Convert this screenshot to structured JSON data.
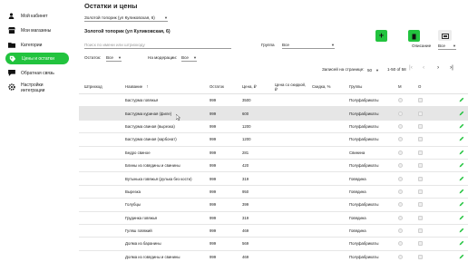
{
  "sidebar": {
    "items": [
      {
        "label": "Мой кабинет",
        "icon": "person-icon",
        "active": false
      },
      {
        "label": "Мои магазины",
        "icon": "store-icon",
        "active": false
      },
      {
        "label": "Категории",
        "icon": "folder-icon",
        "active": false
      },
      {
        "label": "Цены и остатки",
        "icon": "price-tag-icon",
        "active": true
      },
      {
        "label": "Обратная связь",
        "icon": "chat-icon",
        "active": false
      },
      {
        "label": "Настройки",
        "label2": "интеграции",
        "icon": "settings-icon",
        "active": false
      }
    ]
  },
  "page": {
    "title": "Остатки и цены",
    "store_select": "Золотой топорик (ул Куликовская, 6)",
    "store_heading": "Золотой топорик (ул Куликовская, 6)",
    "search_placeholder": "Поиск по имени или штрихкоду",
    "group_label": "Группа",
    "group_value": "Все",
    "stock_label": "Остаток:",
    "stock_value": "Все",
    "moderation_label": "На модерации:",
    "moderation_value": "Все",
    "description_label": "Описание",
    "description_value": "Все",
    "per_page_label": "Записей на странице:",
    "per_page_value": "50",
    "range_text": "1-50 of 58",
    "accent_color": "#22c33e"
  },
  "table": {
    "headers": {
      "barcode": "Штрихкод",
      "name": "Название",
      "stock": "Остаток",
      "price": "Цена, ₽",
      "discount_price": "Цена со скидкой, ₽",
      "discount": "Скидка, %",
      "groups": "Группы",
      "m": "М",
      "o": "О"
    },
    "rows": [
      {
        "name": "Бастурма говяжья",
        "stock": "999",
        "price": "3500",
        "group": "Полуфабрикаты"
      },
      {
        "name": "Бастурма куриная (филе)",
        "stock": "999",
        "price": "600",
        "group": "Полуфабрикаты"
      },
      {
        "name": "Бастурма свиная (вырезка)",
        "stock": "999",
        "price": "1200",
        "group": "Полуфабрикаты"
      },
      {
        "name": "Бастурма свиная (карбонат)",
        "stock": "999",
        "price": "1200",
        "group": "Полуфабрикаты"
      },
      {
        "name": "Бедро свиное",
        "stock": "999",
        "price": "281",
        "group": "Свинина"
      },
      {
        "name": "Блины из говядины и свинины",
        "stock": "999",
        "price": "420",
        "group": "Полуфабрикаты"
      },
      {
        "name": "Вутынька говяжья (рулька без кости)",
        "stock": "999",
        "price": "319",
        "group": "Говядина"
      },
      {
        "name": "Вырезка",
        "stock": "999",
        "price": "950",
        "group": "Говядина"
      },
      {
        "name": "Голубцы",
        "stock": "999",
        "price": "399",
        "group": "Полуфабрикаты"
      },
      {
        "name": "Грудинка говяжья",
        "stock": "999",
        "price": "319",
        "group": "Говядина"
      },
      {
        "name": "Гуляш говяжий",
        "stock": "999",
        "price": "469",
        "group": "Говядина"
      },
      {
        "name": "Долма из баранины",
        "stock": "999",
        "price": "569",
        "group": "Полуфабрикаты"
      },
      {
        "name": "Долма из говядины и свинины",
        "stock": "999",
        "price": "469",
        "group": "Полуфабрикаты"
      }
    ]
  }
}
